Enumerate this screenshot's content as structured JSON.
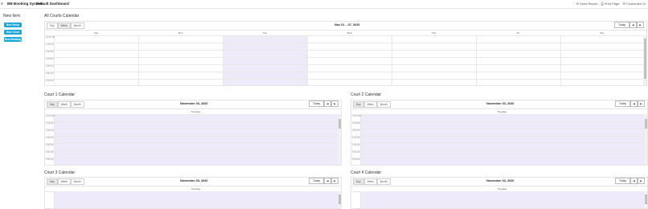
{
  "topbar": {
    "menu_glyph": "≡",
    "app_title": "BB Booking System",
    "separator": "·",
    "dashboard_title": "Default Dashboard",
    "actions": [
      "Send Report",
      "Print Page",
      "Customize UI"
    ]
  },
  "sidebar": {
    "title": "New Item",
    "buttons": [
      "New Setup",
      "New Court",
      "New Booking"
    ]
  },
  "views": [
    "Day",
    "Week",
    "Month"
  ],
  "today_label": "Today",
  "nav_prev": "◀",
  "nav_next": "▶",
  "main_calendar": {
    "panel_title": "All Courts Calendar",
    "active_view": "Week",
    "range_title": "Nov 01 – 07, 2020",
    "days": [
      "Sun",
      "Mon",
      "Tue",
      "Wed",
      "Thu",
      "Fri",
      "Sat"
    ],
    "highlight_day": "Tue",
    "times": [
      "12:00 AM",
      "1:00 AM",
      "2:00 AM",
      "3:00 AM",
      "4:00 AM",
      "5:00 AM",
      "6:00 AM"
    ]
  },
  "court_calendars": [
    {
      "panel_title": "Court 1 Calendar",
      "date_title": "November 03, 2020",
      "day_name": "Tuesday",
      "active_view": "Day",
      "times": [
        "12:00 AM",
        "1:00 AM",
        "2:00 AM",
        "3:00 AM",
        "4:00 AM",
        "5:00 AM",
        "6:00 AM"
      ]
    },
    {
      "panel_title": "Court 2 Calendar",
      "date_title": "November 03, 2020",
      "day_name": "Tuesday",
      "active_view": "Day",
      "times": [
        "12:00 AM",
        "1:00 AM",
        "2:00 AM",
        "3:00 AM",
        "4:00 AM",
        "5:00 AM",
        "6:00 AM"
      ]
    },
    {
      "panel_title": "Court 3 Calendar",
      "date_title": "November 03, 2020",
      "day_name": "Tuesday",
      "active_view": "Day",
      "times": []
    },
    {
      "panel_title": "Court 4 Calendar",
      "date_title": "November 03, 2020",
      "day_name": "Tuesday",
      "active_view": "Day",
      "times": []
    }
  ],
  "colors": {
    "accent": "#1aa7d9",
    "highlight": "#eeeafa",
    "border": "#e4e4e4"
  }
}
